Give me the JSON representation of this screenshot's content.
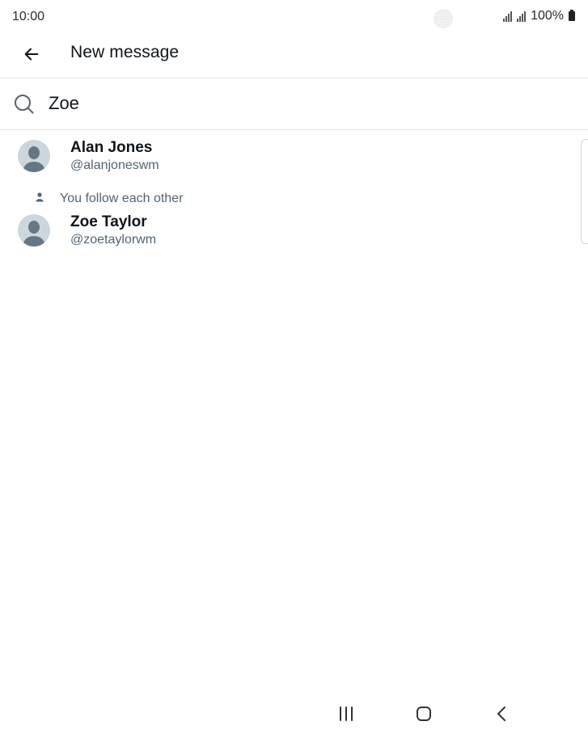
{
  "status_bar": {
    "time": "10:00",
    "battery": "100%"
  },
  "header": {
    "title": "New message",
    "back_icon": "arrow-left-icon"
  },
  "search": {
    "value": "Zoe",
    "icon": "search-icon"
  },
  "results": [
    {
      "name": "Alan Jones",
      "handle": "@alanjoneswm",
      "follow_note": ""
    },
    {
      "name": "Zoe Taylor",
      "handle": "@zoetaylorwm",
      "follow_note": "You follow each other"
    }
  ],
  "nav_bar": {
    "recents_icon": "recents-icon",
    "home_icon": "home-icon",
    "back_icon": "chevron-left-icon"
  },
  "colors": {
    "text_primary": "#0f1419",
    "text_secondary": "#536471",
    "avatar_bg": "#ccd6dd",
    "avatar_fg": "#657786",
    "divider": "#e6e6e6"
  }
}
